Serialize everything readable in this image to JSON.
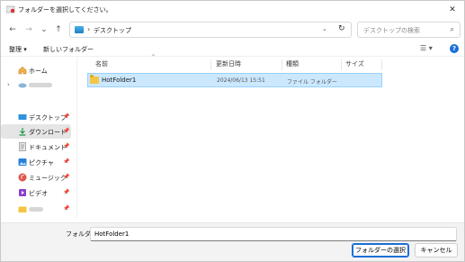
{
  "titlebar": {
    "title": "フォルダーを選択してください。",
    "close": "✕"
  },
  "nav": {
    "back": "←",
    "forward": "→",
    "recent": "⌄",
    "up": "↑"
  },
  "address": {
    "path": "デスクトップ",
    "separator": "›",
    "dropdown": "⌄",
    "refresh": "↻"
  },
  "search": {
    "placeholder": "デスクトップの検索",
    "icon": "⌕"
  },
  "toolbar": {
    "organize": "整理 ▾",
    "new_folder": "新しいフォルダー",
    "view": "☰ ▾",
    "help": "?"
  },
  "sidebar": {
    "items": [
      {
        "label": "ホーム",
        "icon": "home-icon"
      },
      {
        "label": "",
        "icon": "onedrive-icon",
        "blurred": true
      },
      {
        "label": "デスクトップ",
        "icon": "desktop-icon",
        "pinned": true
      },
      {
        "label": "ダウンロード",
        "icon": "download-icon",
        "pinned": true,
        "selected": true
      },
      {
        "label": "ドキュメント",
        "icon": "document-icon",
        "pinned": true
      },
      {
        "label": "ピクチャ",
        "icon": "picture-icon",
        "pinned": true
      },
      {
        "label": "ミュージック",
        "icon": "music-icon",
        "pinned": true
      },
      {
        "label": "ビデオ",
        "icon": "video-icon",
        "pinned": true
      },
      {
        "label": "",
        "icon": "folder-icon",
        "pinned": true,
        "blurred": true
      },
      {
        "label": "",
        "icon": "folder-icon",
        "pinned": true,
        "blurred": true
      }
    ]
  },
  "columns": [
    "名前",
    "更新日時",
    "種類",
    "サイズ"
  ],
  "files": [
    {
      "name": "HotFolder1",
      "modified": "2024/06/13 15:51",
      "type": "ファイル フォルダー",
      "size": ""
    }
  ],
  "footer": {
    "folder_label": "フォルダー:",
    "folder_value": "HotFolder1",
    "select_button": "フォルダーの選択",
    "cancel_button": "キャンセル"
  },
  "colors": {
    "accent": "#1a6fd6",
    "selection_bg": "#cce8ff",
    "selection_border": "#99d1ff"
  }
}
